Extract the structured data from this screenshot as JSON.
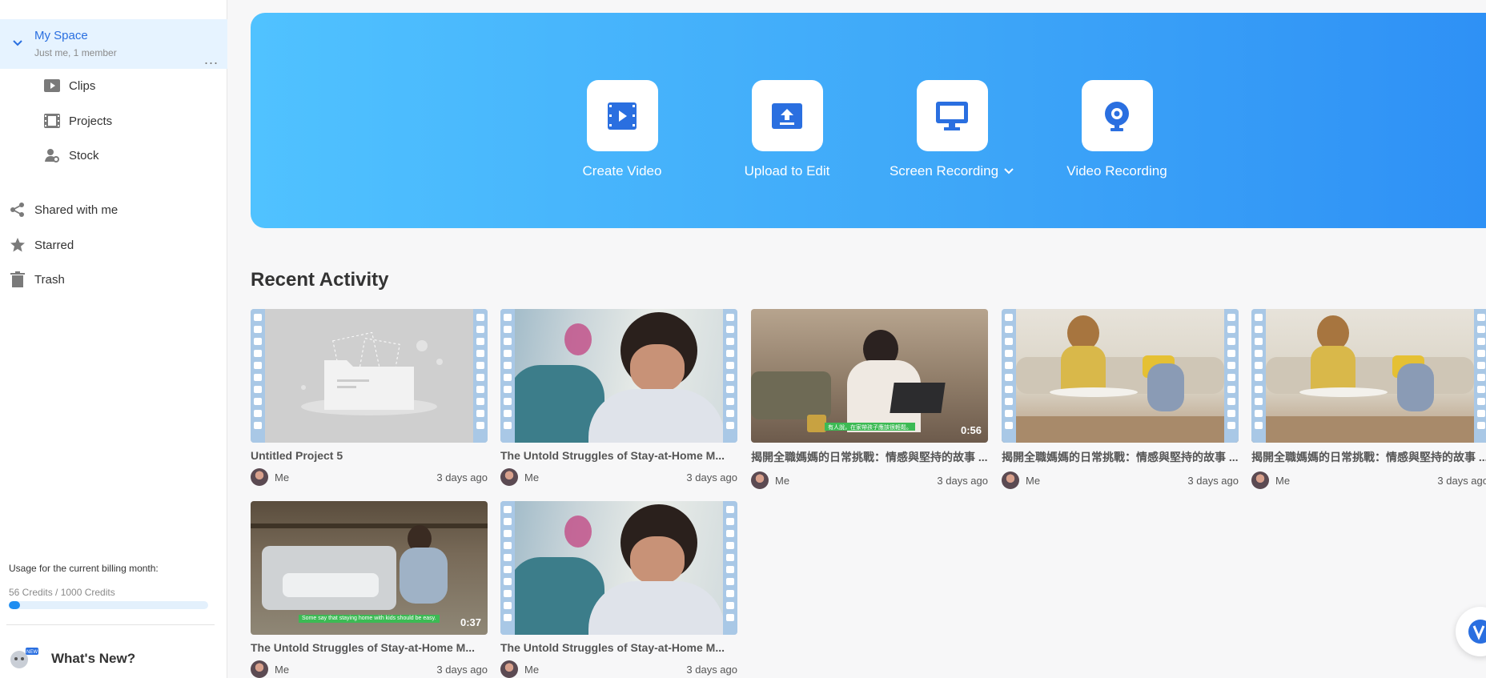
{
  "sidebar": {
    "space": {
      "name": "My Space",
      "sub": "Just me, 1 member",
      "more": "..."
    },
    "space_items": [
      {
        "label": "Clips",
        "icon": "play-icon"
      },
      {
        "label": "Projects",
        "icon": "film-icon"
      },
      {
        "label": "Stock",
        "icon": "stock-icon"
      }
    ],
    "nav": [
      {
        "label": "Shared with me",
        "icon": "share-icon"
      },
      {
        "label": "Starred",
        "icon": "star-icon"
      },
      {
        "label": "Trash",
        "icon": "trash-icon"
      }
    ],
    "usage": {
      "label": "Usage for the current billing month:",
      "value": "56 Credits / 1000 Credits",
      "used": 56,
      "total": 1000
    },
    "whats_new": {
      "badge": "NEW",
      "label": "What's New?"
    }
  },
  "hero": {
    "actions": [
      {
        "label": "Create Video",
        "icon": "film-play-icon"
      },
      {
        "label": "Upload to Edit",
        "icon": "upload-icon"
      },
      {
        "label": "Screen Recording",
        "icon": "monitor-icon",
        "dropdown": true
      },
      {
        "label": "Video Recording",
        "icon": "webcam-icon"
      }
    ]
  },
  "recent": {
    "title": "Recent Activity",
    "items": [
      {
        "title": "Untitled Project 5",
        "owner": "Me",
        "time": "3 days ago",
        "duration": "",
        "thumb": "folder",
        "filmstrip": true
      },
      {
        "title": "The Untold Struggles of Stay-at-Home M...",
        "owner": "Me",
        "time": "3 days ago",
        "duration": "",
        "thumb": "child",
        "filmstrip": true
      },
      {
        "title": "揭開全職媽媽的日常挑戰：情感與堅持的故事 ...",
        "owner": "Me",
        "time": "3 days ago",
        "duration": "0:56",
        "thumb": "woman-laptop",
        "filmstrip": false,
        "caption": "有人說，在家帶孩子應該很輕鬆。"
      },
      {
        "title": "揭開全職媽媽的日常挑戰：情感與堅持的故事 ...",
        "owner": "Me",
        "time": "3 days ago",
        "duration": "",
        "thumb": "living-room",
        "filmstrip": true
      },
      {
        "title": "揭開全職媽媽的日常挑戰：情感與堅持的故事 ...",
        "owner": "Me",
        "time": "3 days ago",
        "duration": "",
        "thumb": "living-room",
        "filmstrip": true
      },
      {
        "title": "The Untold Struggles of Stay-at-Home M...",
        "owner": "Me",
        "time": "3 days ago",
        "duration": "0:37",
        "thumb": "patio",
        "filmstrip": false,
        "caption": "Some say that staying home with kids should be easy."
      },
      {
        "title": "The Untold Struggles of Stay-at-Home M...",
        "owner": "Me",
        "time": "3 days ago",
        "duration": "",
        "thumb": "child",
        "filmstrip": true
      }
    ]
  },
  "colors": {
    "accent": "#2a6fe0",
    "hero_start": "#50c2ff",
    "hero_end": "#2e90f5",
    "usage_fill": "#1f8ef1"
  }
}
